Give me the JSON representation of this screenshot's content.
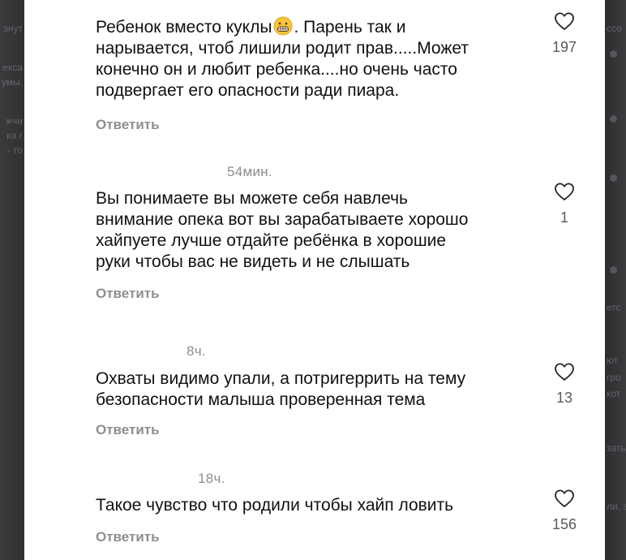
{
  "comments": [
    {
      "time": "",
      "text_before_emoji": "Ребенок вместо куклы",
      "emoji": "grimacing-face-emoji",
      "text_lines": [
        ". Парень так и",
        "нарывается, чтоб лишили родит прав.....Может",
        "конечно он и любит ребенка....но очень часто",
        "подвергает его опасности ради пиара."
      ],
      "reply_label": "Ответить",
      "likes": "197"
    },
    {
      "time": "54мин.",
      "text_lines": [
        "Вы понимаете вы можете себя навлечь",
        "внимание опека вот вы зарабатываете хорошо",
        "хайпуете лучше отдайте ребёнка в хорошие",
        "руки чтобы вас не видеть и не слышать"
      ],
      "reply_label": "Ответить",
      "likes": "1"
    },
    {
      "time": "8ч.",
      "text_lines": [
        "Охваты видимо упали, а потригеррить на тему",
        "безопасности малыша проверенная тема"
      ],
      "reply_label": "Ответить",
      "likes": "13"
    },
    {
      "time": "18ч.",
      "text_lines": [
        "Такое чувство что родили чтобы хайп ловить"
      ],
      "reply_label": "Ответить",
      "likes": "156"
    }
  ],
  "background_fragments": {
    "left": [
      "знут",
      "екса",
      "умы,",
      "жчи",
      "ка г",
      "- то"
    ],
    "right": [
      "ссо",
      "етс",
      "ют",
      "гро",
      "кот",
      "зать",
      "ли, з"
    ]
  },
  "colors": {
    "text": "#111111",
    "muted": "#8e8e8e",
    "like_count": "#5b5b5b",
    "panel": "#ffffff",
    "backdrop": "#2e2f31"
  },
  "icons": [
    "heart-outline-icon",
    "grimacing-face-emoji"
  ]
}
